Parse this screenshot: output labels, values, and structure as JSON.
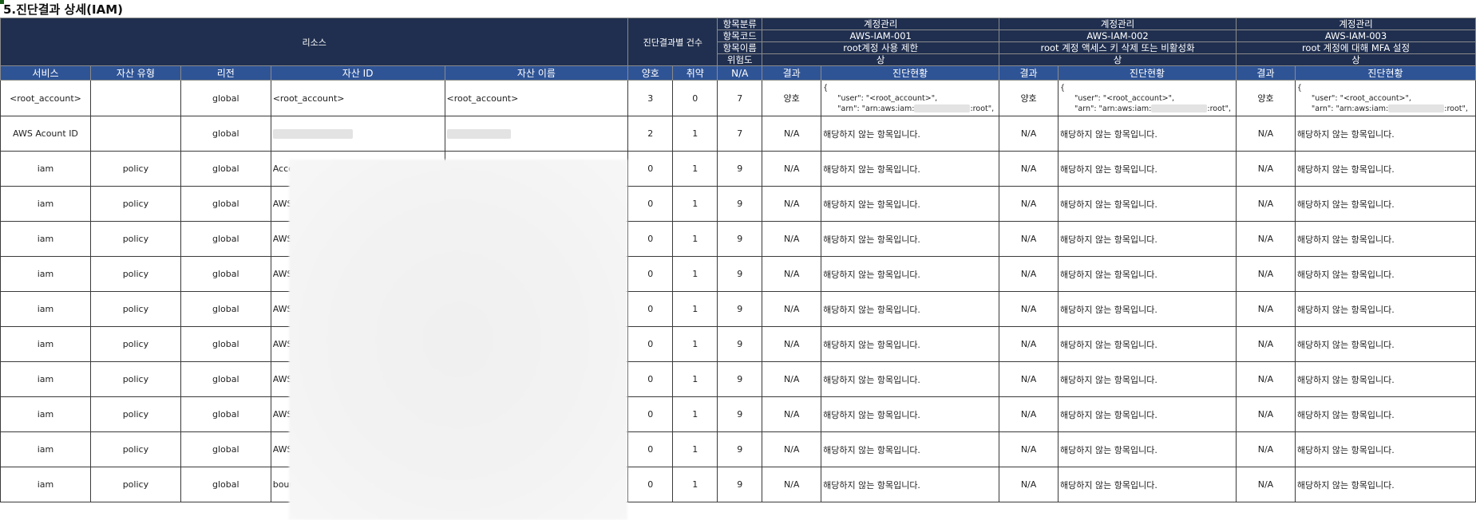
{
  "title": "5.진단결과 상세(IAM)",
  "header": {
    "resource_label": "리소스",
    "count_label": "진단결과별 건수",
    "meta_labels": [
      "항목분류",
      "항목코드",
      "항목이름",
      "위험도"
    ],
    "items": [
      {
        "category": "계정관리",
        "code": "AWS-IAM-001",
        "name": "root계정 사용 제한",
        "risk": "상"
      },
      {
        "category": "계정관리",
        "code": "AWS-IAM-002",
        "name": "root 계정 액세스 키 삭제 또는 비활성화",
        "risk": "상"
      },
      {
        "category": "계정관리",
        "code": "AWS-IAM-003",
        "name": "root 계정에 대해 MFA 설정",
        "risk": "상"
      }
    ],
    "columns": [
      "서비스",
      "자산 유형",
      "리전",
      "자산 ID",
      "자산 이름",
      "양호",
      "취약",
      "N/A"
    ],
    "item_columns": [
      "결과",
      "진단현황"
    ]
  },
  "rows": [
    {
      "service": "<root_account>",
      "type": "",
      "region": "global",
      "asset_id": "<root_account>",
      "asset_name": "<root_account>",
      "good": "3",
      "vuln": "0",
      "na": "7",
      "results": [
        {
          "result": "양호",
          "json_open": "{",
          "json_user": "\"user\": \"<root_account>\",",
          "json_arn_pre": "\"arn\": \"arn:aws:iam:",
          "json_arn_post": ":root\","
        },
        {
          "result": "양호",
          "json_open": "{",
          "json_user": "\"user\": \"<root_account>\",",
          "json_arn_pre": "\"arn\": \"arn:aws:iam:",
          "json_arn_post": ":root\","
        },
        {
          "result": "양호",
          "json_open": "{",
          "json_user": "\"user\": \"<root_account>\",",
          "json_arn_pre": "\"arn\": \"arn:aws:iam:",
          "json_arn_post": ":root\","
        }
      ]
    },
    {
      "service": "AWS Acount ID",
      "type": "",
      "region": "global",
      "asset_id": "",
      "asset_name": "",
      "good": "2",
      "vuln": "1",
      "na": "7",
      "result": "N/A",
      "status": "해당하지 않는 항목입니다."
    },
    {
      "service": "iam",
      "type": "policy",
      "region": "global",
      "asset_id": "AccessA",
      "asset_name": "",
      "good": "0",
      "vuln": "1",
      "na": "9",
      "result": "N/A",
      "status": "해당하지 않는 항목입니다."
    },
    {
      "service": "iam",
      "type": "policy",
      "region": "global",
      "asset_id": "AWS-C",
      "asset_name": "",
      "good": "0",
      "vuln": "1",
      "na": "9",
      "result": "N/A",
      "status": "해당하지 않는 항목입니다."
    },
    {
      "service": "iam",
      "type": "policy",
      "region": "global",
      "asset_id": "AWSCo",
      "asset_name": "",
      "good": "0",
      "vuln": "1",
      "na": "9",
      "result": "N/A",
      "status": "해당하지 않는 항목입니다."
    },
    {
      "service": "iam",
      "type": "policy",
      "region": "global",
      "asset_id": "AWSLa",
      "asset_name": "",
      "good": "0",
      "vuln": "1",
      "na": "9",
      "result": "N/A",
      "status": "해당하지 않는 항목입니다."
    },
    {
      "service": "iam",
      "type": "policy",
      "region": "global",
      "asset_id": "AWSLa",
      "asset_name": "",
      "good": "0",
      "vuln": "1",
      "na": "9",
      "result": "N/A",
      "status": "해당하지 않는 항목입니다."
    },
    {
      "service": "iam",
      "type": "policy",
      "region": "global",
      "asset_id": "AWSLa",
      "asset_name": "",
      "good": "0",
      "vuln": "1",
      "na": "9",
      "result": "N/A",
      "status": "해당하지 않는 항목입니다."
    },
    {
      "service": "iam",
      "type": "policy",
      "region": "global",
      "asset_id": "AWSLa",
      "asset_name": "",
      "good": "0",
      "vuln": "1",
      "na": "9",
      "result": "N/A",
      "status": "해당하지 않는 항목입니다."
    },
    {
      "service": "iam",
      "type": "policy",
      "region": "global",
      "asset_id": "AWSLa",
      "asset_name": "",
      "good": "0",
      "vuln": "1",
      "na": "9",
      "result": "N/A",
      "status": "해당하지 않는 항목입니다."
    },
    {
      "service": "iam",
      "type": "policy",
      "region": "global",
      "asset_id": "AWSLo",
      "asset_name": "",
      "good": "0",
      "vuln": "1",
      "na": "9",
      "result": "N/A",
      "status": "해당하지 않는 항목입니다."
    },
    {
      "service": "iam",
      "type": "policy",
      "region": "global",
      "asset_id": "bounda",
      "asset_name": "",
      "good": "0",
      "vuln": "1",
      "na": "9",
      "result": "N/A",
      "status": "해당하지 않는 항목입니다."
    }
  ]
}
